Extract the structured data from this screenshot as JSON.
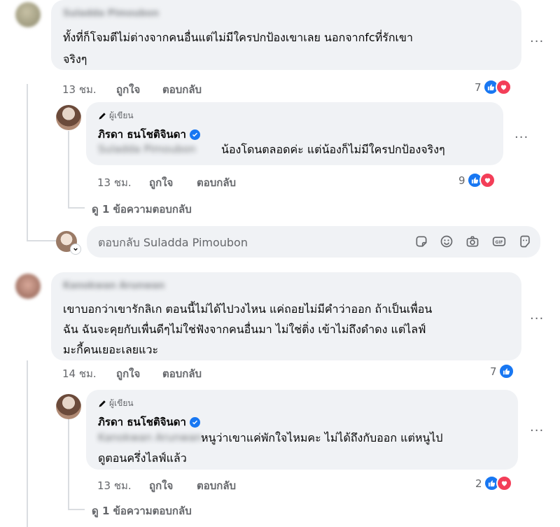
{
  "comments": [
    {
      "commenter_name": "Suladda Pimoubon",
      "text_line1": "ทั้งที่ก็โจมตีไม่ต่างจากคนอื่นแต่ไม่มีใครปกป้องเขาเลย นอกจากfcที่รักเขา",
      "text_line2": "จริงๆ",
      "time": "13 ชม.",
      "like_label": "ถูกใจ",
      "reply_label": "ตอบกลับ",
      "reaction_count": "7",
      "reply": {
        "author_tag": "ผู้เขียน",
        "name": "ภิรดา ธนโชติจินดา",
        "mention": "Suladda Pimoubon",
        "text_line1": "น้องโดนตลอดค่ะ แต่น้องก็ไม่มีใครปกป้องจริงๆ",
        "time": "13 ชม.",
        "like_label": "ถูกใจ",
        "reply_label": "ตอบกลับ",
        "reaction_count": "9"
      },
      "view_replies": "ดู 1 ข้อความตอบกลับ",
      "reply_box_placeholder": "ตอบกลับ Suladda Pimoubon"
    },
    {
      "commenter_name": "Kanokwan Arunwan",
      "text_line1": "เขาบอกว่าเขารักลิเก ตอนนี้ไม่ได้ไปวงไหน แค่ถอยไม่มีคำว่าออก ถ้าเป็นเพื่อน",
      "text_line2": "ฉัน ฉันจะคุยกับเพื่นดีๆไม่ใช่ฟังจากคนอื่นมา ไม่ใช่ติ่ง เข้าไม่ถึงดำดง แต่ไลฟ์",
      "text_line3": "มะกี้คนเยอะเลยแวะ",
      "time": "14 ชม.",
      "like_label": "ถูกใจ",
      "reply_label": "ตอบกลับ",
      "reaction_count": "7",
      "reply": {
        "author_tag": "ผู้เขียน",
        "name": "ภิรดา ธนโชติจินดา",
        "mention": "Kanokwan Arunwan",
        "text_line1": "หนูว่าเขาแค่พักใจไหมคะ ไม่ได้ถึงกับออก แต่หนูไป",
        "text_line2": "ดูตอนครึ่งไลฟ์แล้ว",
        "time": "13 ชม.",
        "like_label": "ถูกใจ",
        "reply_label": "ตอบกลับ",
        "reaction_count": "2"
      },
      "view_replies": "ดู 1 ข้อความตอบกลับ"
    }
  ],
  "more_options": "...",
  "icons": [
    "more-options-icon",
    "like-reaction-icon",
    "love-reaction-icon",
    "pen-icon",
    "verified-badge-icon",
    "sticker-icon",
    "emoji-icon",
    "camera-icon",
    "gif-icon",
    "avatar-sticker-icon"
  ],
  "colors": {
    "like": "#1877f2",
    "love": "#f33e58",
    "bubble": "#f0f2f5",
    "meta": "#65676b",
    "thread_line": "#dadde1"
  }
}
